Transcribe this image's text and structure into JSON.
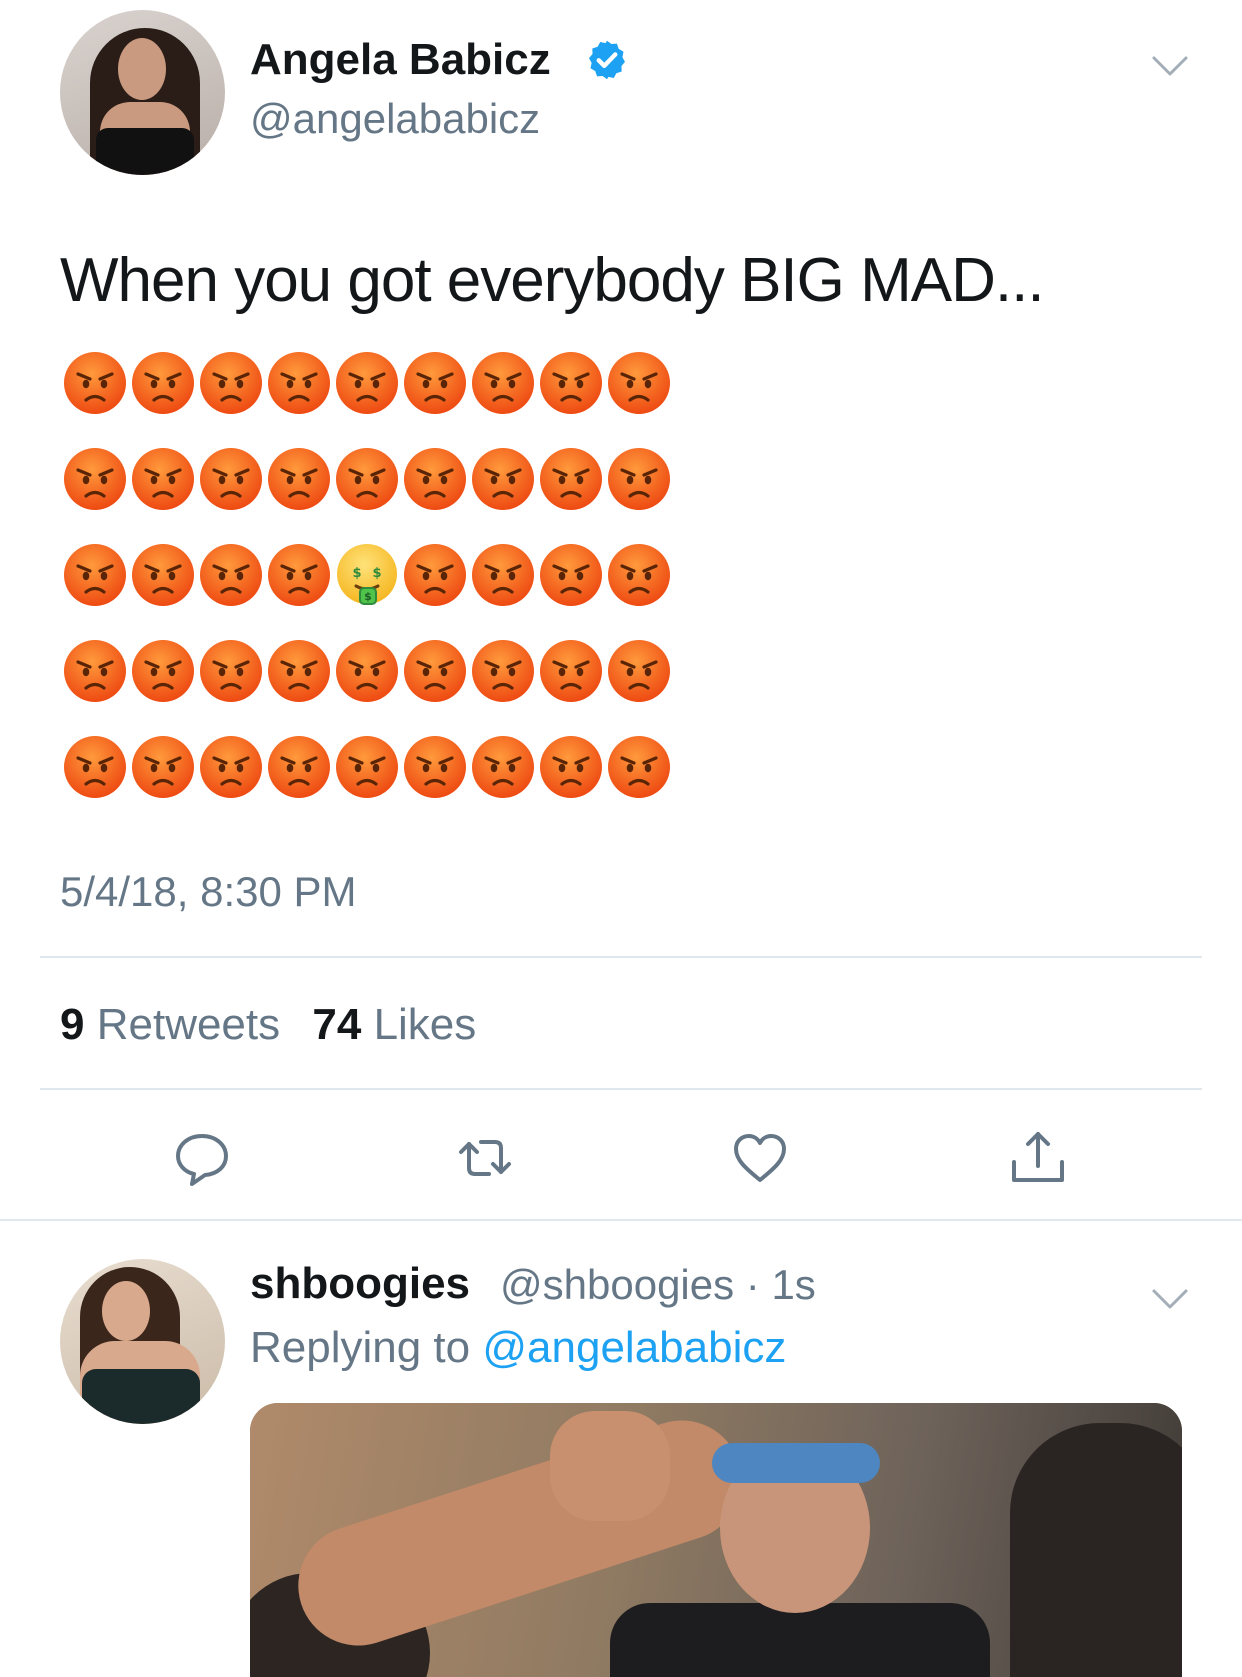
{
  "tweet": {
    "author_name": "Angela Babicz",
    "handle": "@angelababicz",
    "text": "When you got everybody BIG MAD...",
    "emoji_rows": [
      [
        "angry",
        "angry",
        "angry",
        "angry",
        "angry",
        "angry",
        "angry",
        "angry",
        "angry"
      ],
      [
        "angry",
        "angry",
        "angry",
        "angry",
        "angry",
        "angry",
        "angry",
        "angry",
        "angry"
      ],
      [
        "angry",
        "angry",
        "angry",
        "angry",
        "money-mouth",
        "angry",
        "angry",
        "angry",
        "angry"
      ],
      [
        "angry",
        "angry",
        "angry",
        "angry",
        "angry",
        "angry",
        "angry",
        "angry",
        "angry"
      ],
      [
        "angry",
        "angry",
        "angry",
        "angry",
        "angry",
        "angry",
        "angry",
        "angry",
        "angry"
      ]
    ],
    "timestamp": "5/4/18, 8:30 PM",
    "retweets_count": "9",
    "retweets_label": "Retweets",
    "likes_count": "74",
    "likes_label": "Likes"
  },
  "actions": [
    "reply-icon",
    "retweet-icon",
    "like-icon",
    "share-icon"
  ],
  "reply": {
    "author_name": "shboogies",
    "meta": "@shboogies · 1s",
    "replying_prefix": "Replying to",
    "replying_mention": "@angelababicz"
  },
  "colors": {
    "text": "#14171a",
    "secondary": "#657786",
    "accent": "#1da1f2",
    "divider": "#e1e8ed",
    "emoji_angry": "#f4581c"
  }
}
